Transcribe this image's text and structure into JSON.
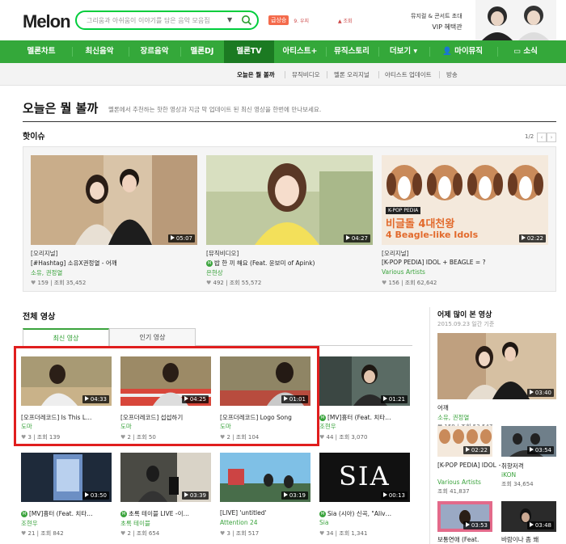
{
  "header": {
    "logo_text": "Melon",
    "search_placeholder": "그리움과 아쉬움이 이야기를 담은 음악 모음집",
    "search_dropdown": "▼",
    "rank_tag": "급상승",
    "rank_item1": "9. 우지",
    "rank_item2": "▲ 조회",
    "ad_line1": "뮤지컬 & 콘서트 초대",
    "ad_line2": "VIP 혜택관"
  },
  "nav": {
    "items": [
      "멜론차트",
      "최신음악",
      "장르음악",
      "멜론DJ",
      "멜론TV",
      "아티스트+",
      "뮤직스토리",
      "더보기 ▾",
      "마이뮤직",
      "소식"
    ]
  },
  "subnav": {
    "items": [
      "오늘은 뭘 볼까",
      "뮤직비디오",
      "멜론 오리지널",
      "아티스트 업데이트",
      "방송"
    ]
  },
  "page": {
    "title": "오늘은 뭘 볼까",
    "desc": "멜론에서 추천하는 핫한 영상과 지금 막 업데이트 된 최신 영상을 한번에 만나보세요."
  },
  "hot": {
    "title": "핫이슈",
    "pager": "1/2",
    "prev": "‹",
    "next": "›",
    "items": [
      {
        "category": "[오리지널]",
        "title": "[#Hashtag] 소유X권정열 - 어깨",
        "artist": "소유, 권정열",
        "likes": "159",
        "views": "조회 35,452",
        "duration": "05:07"
      },
      {
        "category": "[뮤직비디오]",
        "title": "밥 한 끼 해요 (Feat. 윤보미 of Apink)",
        "artist": "은현상",
        "likes": "492",
        "views": "조회 55,572",
        "duration": "04:27"
      },
      {
        "category": "[오리지널]",
        "title": "[K-POP PEDIA] IDOL + BEAGLE = ?",
        "artist": "Various Artists",
        "likes": "156",
        "views": "조회 62,642",
        "duration": "02:22",
        "thumb_tag": "K-POP PEDIA",
        "thumb_line1": "비글돌 4대천왕",
        "thumb_line2": "4 Beagle-like Idols"
      }
    ]
  },
  "all": {
    "title": "전체 영상",
    "tab_latest": "최신 영상",
    "tab_popular": "인기 영상",
    "row1": [
      {
        "title": "[오프더레코드] Is This L…",
        "artist": "도마",
        "likes": "3",
        "views": "조회 139",
        "duration": "04:33"
      },
      {
        "title": "[오프더레코드] 섭섭하기",
        "artist": "도마",
        "likes": "2",
        "views": "조회 50",
        "duration": "04:25"
      },
      {
        "title": "[오프더레코드] Logo Song",
        "artist": "도마",
        "likes": "2",
        "views": "조회 104",
        "duration": "01:01"
      },
      {
        "title": "[MV]흉터 (Feat. 치타…",
        "artist": "조현우",
        "likes": "44",
        "views": "조회 3,070",
        "duration": "01:21"
      }
    ],
    "row2": [
      {
        "title": "[MV]흉터 (Feat. 치타…",
        "artist": "조현우",
        "likes": "21",
        "views": "조회 842",
        "duration": "03:50"
      },
      {
        "title": "초록 테이블 LIVE -이…",
        "artist": "초록 테이블",
        "likes": "2",
        "views": "조회 654",
        "duration": "03:39"
      },
      {
        "title": "[LIVE] 'untitled'",
        "artist": "Attention 24",
        "likes": "3",
        "views": "조회 517",
        "duration": "03:19"
      },
      {
        "title": "Sia (시아) 신곡, \"Aliv…",
        "artist": "Sia",
        "likes": "34",
        "views": "조회 1,341",
        "duration": "00:13",
        "thumb_text": "SIA"
      }
    ]
  },
  "side": {
    "title": "어제 많이 본 영상",
    "date": "2015.09.23 일간 기준",
    "main": {
      "title": "어깨",
      "artist": "소유, 권정열",
      "likes": "159",
      "views": "조회 53,547",
      "duration": "03:40"
    },
    "items": [
      {
        "title": "[K-POP PEDIA] IDOL + BEA…",
        "artist": "Various Artists",
        "views": "조회 41,837",
        "duration": "02:22"
      },
      {
        "title": "취향저격",
        "artist": "iKON",
        "views": "조회 34,654",
        "duration": "03:54"
      },
      {
        "title": "보통연애 (Feat.",
        "duration": "03:53"
      },
      {
        "title": "바람이나 좀 쐐",
        "duration": "03:48"
      }
    ]
  }
}
